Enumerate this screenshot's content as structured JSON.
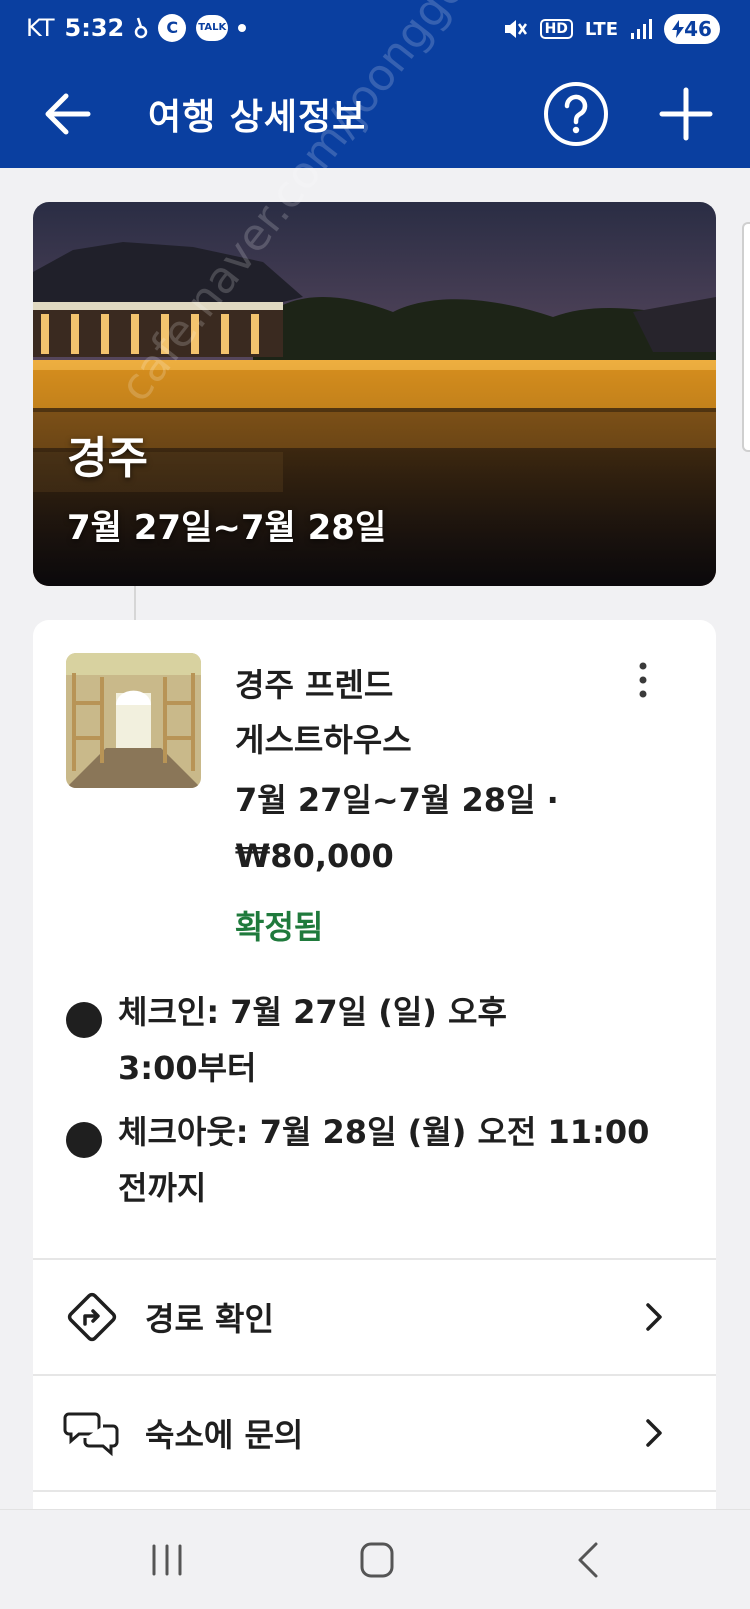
{
  "status_bar": {
    "carrier": "KT",
    "time": "5:32",
    "app_badge": "C",
    "talk_badge": "TALK",
    "hd_label": "HD",
    "network": "LTE",
    "battery": "46"
  },
  "app_bar": {
    "title": "여행 상세정보"
  },
  "hero": {
    "city": "경주",
    "dates": "7월 27일~7월 28일"
  },
  "booking": {
    "name": "경주 프렌드\n게스트하우스",
    "stay": "7월 27일~7월 28일 ·\n₩80,000",
    "status": "확정됨",
    "checkin": "체크인: 7월 27일 (일) 오후\n3:00부터",
    "checkout": "체크아웃: 7월 28일 (월) 오전 11:00\n전까지"
  },
  "actions": [
    {
      "label": "경로 확인",
      "icon": "directions-icon"
    },
    {
      "label": "숙소에 문의",
      "icon": "chat-bubbles-icon"
    }
  ],
  "watermark": "cafe.naver.com/joonggonara",
  "colors": {
    "primary": "#0a3fa0",
    "confirmed": "#1f7a3c"
  }
}
